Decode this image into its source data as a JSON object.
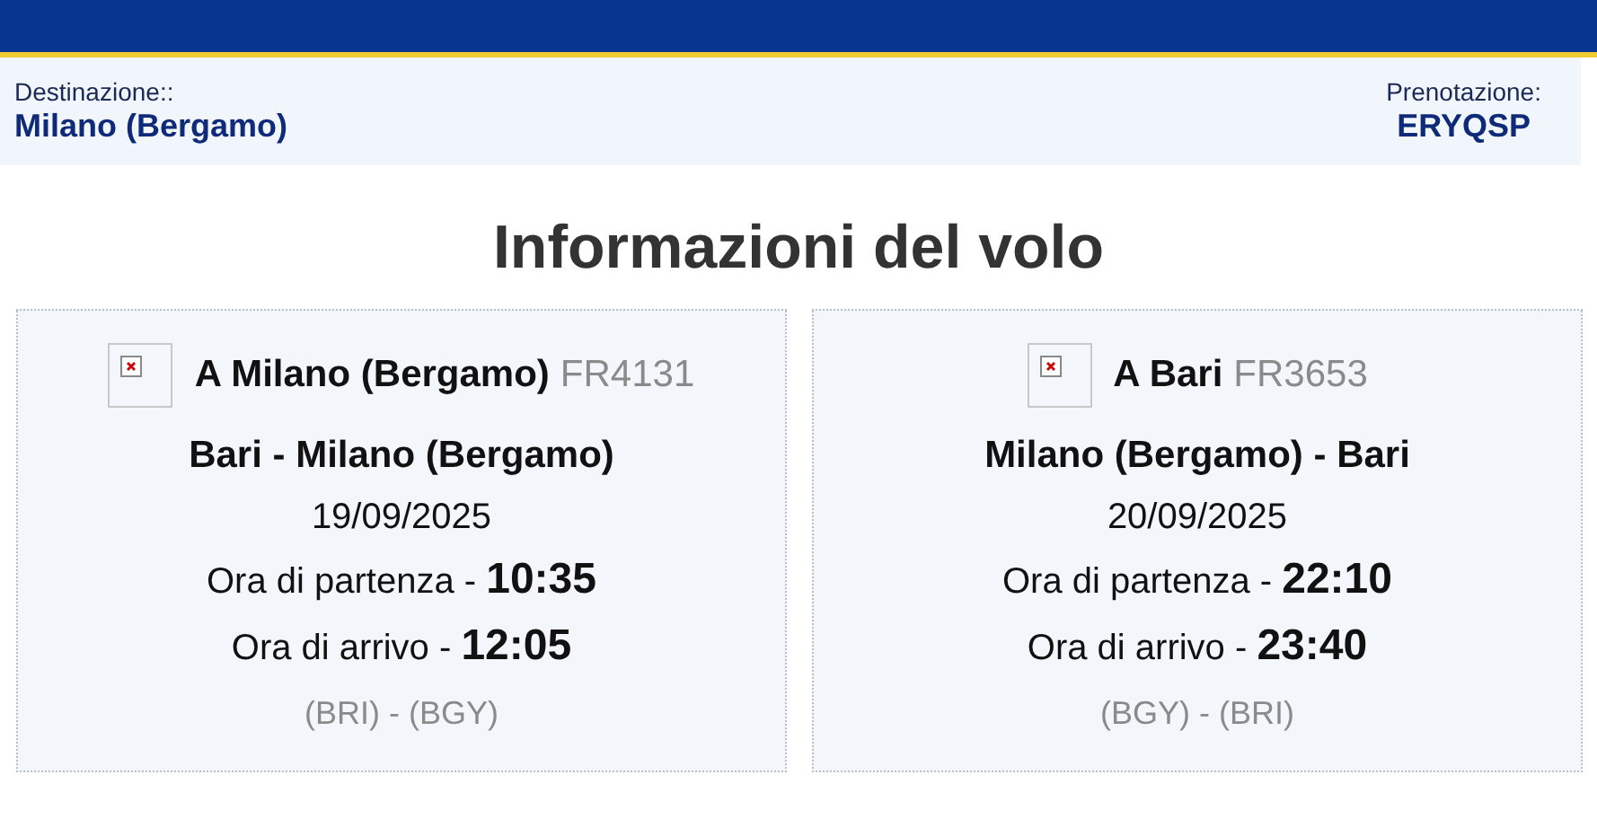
{
  "booking_bar": {
    "destination_label": "Destinazione::",
    "destination": "Milano (Bergamo)",
    "booking_label": "Prenotazione:",
    "booking_code": "ERYQSP"
  },
  "title": "Informazioni del volo",
  "flights": [
    {
      "heading": "A Milano (Bergamo)",
      "flight_number": "FR4131",
      "route": "Bari - Milano (Bergamo)",
      "date": "19/09/2025",
      "departure": "Ora di partenza - **10:35**",
      "arrival": "Ora di arrivo - **12:05**",
      "airports": "(BRI) - (BGY)"
    },
    {
      "heading": "A Bari",
      "flight_number": "FR3653",
      "route": "Milano (Bergamo) - Bari",
      "date": "20/09/2025",
      "departure": "Ora di partenza - **22:10**",
      "arrival": "Ora di arrivo - **23:40**",
      "airports": "(BGY) - (BRI)"
    }
  ]
}
